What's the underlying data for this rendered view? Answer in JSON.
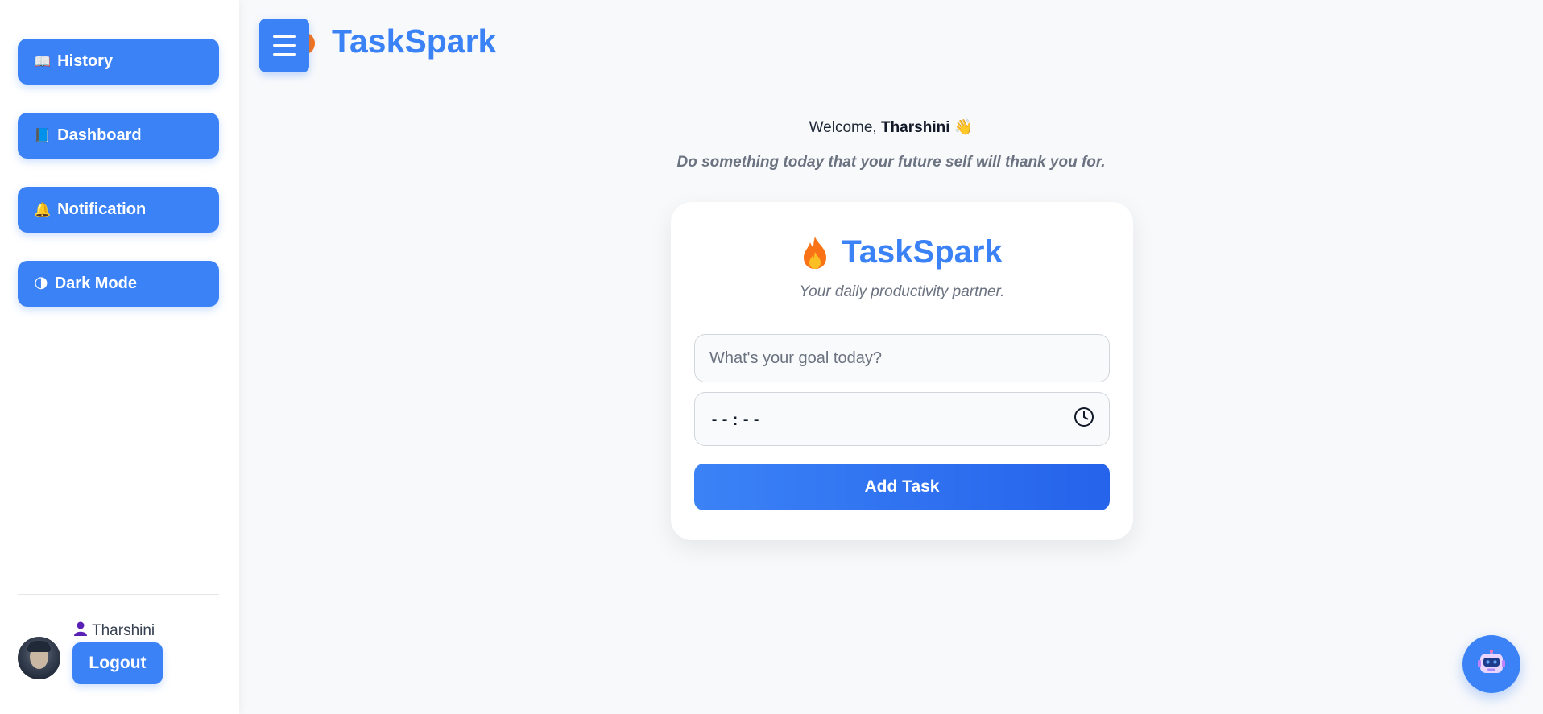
{
  "sidebar": {
    "items": [
      {
        "label": "History",
        "icon": "book-icon"
      },
      {
        "label": "Dashboard",
        "icon": "notebook-icon"
      },
      {
        "label": "Notification",
        "icon": "bell-icon"
      },
      {
        "label": "Dark Mode",
        "icon": "half-moon-icon"
      }
    ],
    "user": {
      "name": "Tharshini",
      "logout_label": "Logout"
    }
  },
  "header": {
    "title": "TaskSpark"
  },
  "welcome": {
    "prefix": "Welcome, ",
    "name": "Tharshini",
    "emoji": "👋",
    "quote": "Do something today that your future self will thank you for."
  },
  "card": {
    "title": "TaskSpark",
    "subtitle": "Your daily productivity partner.",
    "goal_placeholder": "What's your goal today?",
    "goal_value": "",
    "time_value": "--:--",
    "add_label": "Add Task"
  },
  "colors": {
    "accent": "#3b82f6",
    "accent_dark": "#2563eb"
  }
}
